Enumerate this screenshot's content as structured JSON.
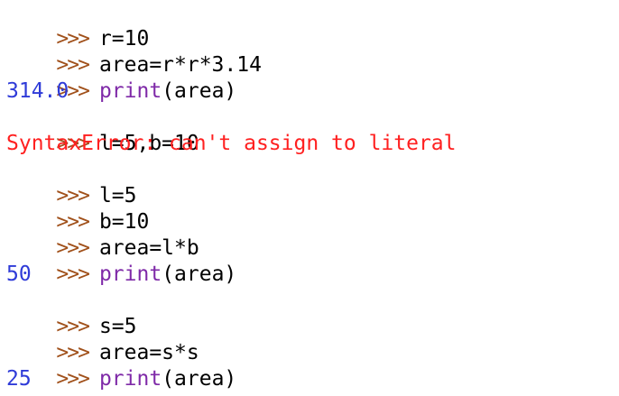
{
  "shell": {
    "prompt": ">>>",
    "lines": [
      {
        "type": "input",
        "code": "r=10"
      },
      {
        "type": "input",
        "code": "area=r*r*3.14"
      },
      {
        "type": "input",
        "kw": "print",
        "code": "(area)"
      },
      {
        "type": "output",
        "text": "314.0"
      },
      {
        "type": "input",
        "code": "l=5,b=10"
      },
      {
        "type": "error",
        "text": "SyntaxError: can't assign to literal"
      },
      {
        "type": "input",
        "code": "l=5"
      },
      {
        "type": "input",
        "code": "b=10"
      },
      {
        "type": "input",
        "code": "area=l*b"
      },
      {
        "type": "input",
        "kw": "print",
        "code": "(area)"
      },
      {
        "type": "output",
        "text": "50"
      },
      {
        "type": "input",
        "code": "s=5"
      },
      {
        "type": "input",
        "code": "area=s*s"
      },
      {
        "type": "input",
        "kw": "print",
        "code": "(area)"
      },
      {
        "type": "output",
        "text": "25"
      }
    ]
  },
  "colors": {
    "prompt": "#a0501a",
    "keyword": "#7f2aa8",
    "output": "#2f3bd8",
    "error": "#ff2020",
    "code": "#000000"
  }
}
